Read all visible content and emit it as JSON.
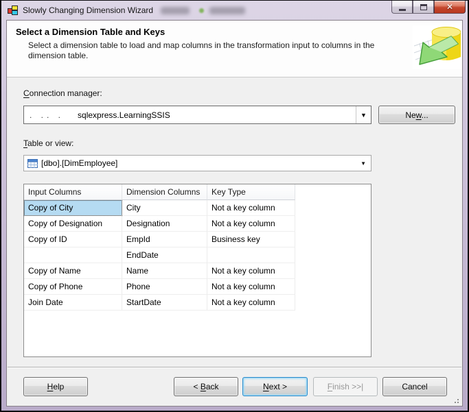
{
  "window": {
    "title": "Slowly Changing Dimension Wizard"
  },
  "header": {
    "title": "Select a Dimension Table and Keys",
    "description": "Select a dimension table to load and map columns in the transformation input to columns in the dimension table."
  },
  "connection": {
    "label": {
      "label": "Connection manager:",
      "mnemonic": 0
    },
    "redacted_remnant": ". .. .",
    "value": "sqlexpress.LearningSSIS",
    "new_button": {
      "label": "New...",
      "mnemonic": 2
    }
  },
  "table_or_view": {
    "label": {
      "label": "Table or view:",
      "mnemonic": 0
    },
    "value": "[dbo].[DimEmployee]"
  },
  "mapping_table": {
    "columns": [
      "Input Columns",
      "Dimension Columns",
      "Key Type"
    ],
    "rows": [
      {
        "input": "Copy of City",
        "dimension": "City",
        "key_type": "Not a key column",
        "selected": true
      },
      {
        "input": "Copy of Designation",
        "dimension": "Designation",
        "key_type": "Not a key column",
        "selected": false
      },
      {
        "input": "Copy of ID",
        "dimension": "EmpId",
        "key_type": "Business key",
        "selected": false
      },
      {
        "input": "",
        "dimension": "EndDate",
        "key_type": "",
        "selected": false
      },
      {
        "input": "Copy of Name",
        "dimension": "Name",
        "key_type": "Not a key column",
        "selected": false
      },
      {
        "input": "Copy of Phone",
        "dimension": "Phone",
        "key_type": "Not a key column",
        "selected": false
      },
      {
        "input": "Join Date",
        "dimension": "StartDate",
        "key_type": "Not a key column",
        "selected": false
      }
    ]
  },
  "footer": {
    "help": {
      "label": "Help",
      "mnemonic": 0
    },
    "back": {
      "label": "< Back",
      "mnemonic": 2
    },
    "next": {
      "label": "Next >",
      "mnemonic": 0
    },
    "finish": {
      "label": "Finish >>|",
      "mnemonic": 0
    },
    "cancel_label": "Cancel"
  },
  "icons": {
    "combo_arrow": "▼",
    "close": "✕"
  },
  "colors": {
    "selection": "#b5dbf2",
    "frame": "#cfc4dc",
    "close_button": "#c4472e",
    "default_button_border": "#2d8ac9"
  }
}
